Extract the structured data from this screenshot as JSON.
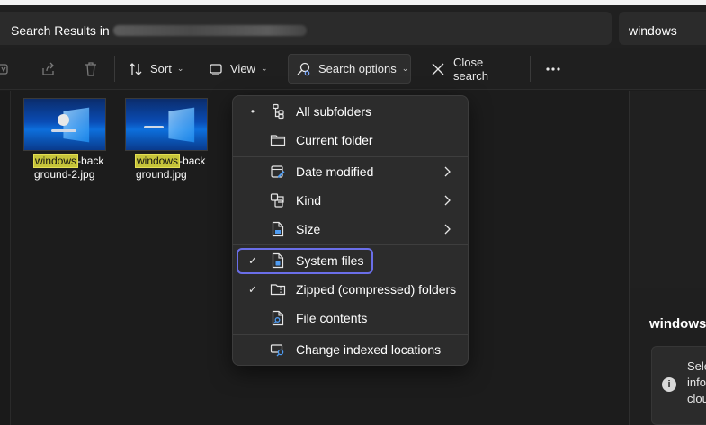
{
  "address": {
    "prefix": "Search Results in"
  },
  "search": {
    "query": "windows"
  },
  "toolbar": {
    "sort_label": "Sort",
    "view_label": "View",
    "search_options_label": "Search options",
    "close_search_label": "Close search",
    "more_label": "..."
  },
  "files": [
    {
      "highlight": "windows",
      "rest": "-background-2.jpg"
    },
    {
      "highlight": "windows",
      "rest": "-background.jpg"
    }
  ],
  "menu": {
    "items": [
      {
        "label": "All subfolders",
        "mark": "•"
      },
      {
        "label": "Current folder",
        "mark": ""
      },
      {
        "label": "Date modified",
        "mark": "",
        "submenu": true
      },
      {
        "label": "Kind",
        "mark": "",
        "submenu": true
      },
      {
        "label": "Size",
        "mark": "",
        "submenu": true
      },
      {
        "label": "System files",
        "mark": "✓"
      },
      {
        "label": "Zipped (compressed) folders",
        "mark": "✓"
      },
      {
        "label": "File contents",
        "mark": ""
      },
      {
        "label": "Change indexed locations",
        "mark": ""
      }
    ]
  },
  "details": {
    "title": "windows",
    "card_text": "Sele\ninfo\nclou",
    "info_icon": "i"
  },
  "colors": {
    "highlight": "#c6c43a",
    "focus_ring": "#6a6ee8",
    "menu_bg": "#2c2c2c",
    "background": "#1c1c1c"
  }
}
